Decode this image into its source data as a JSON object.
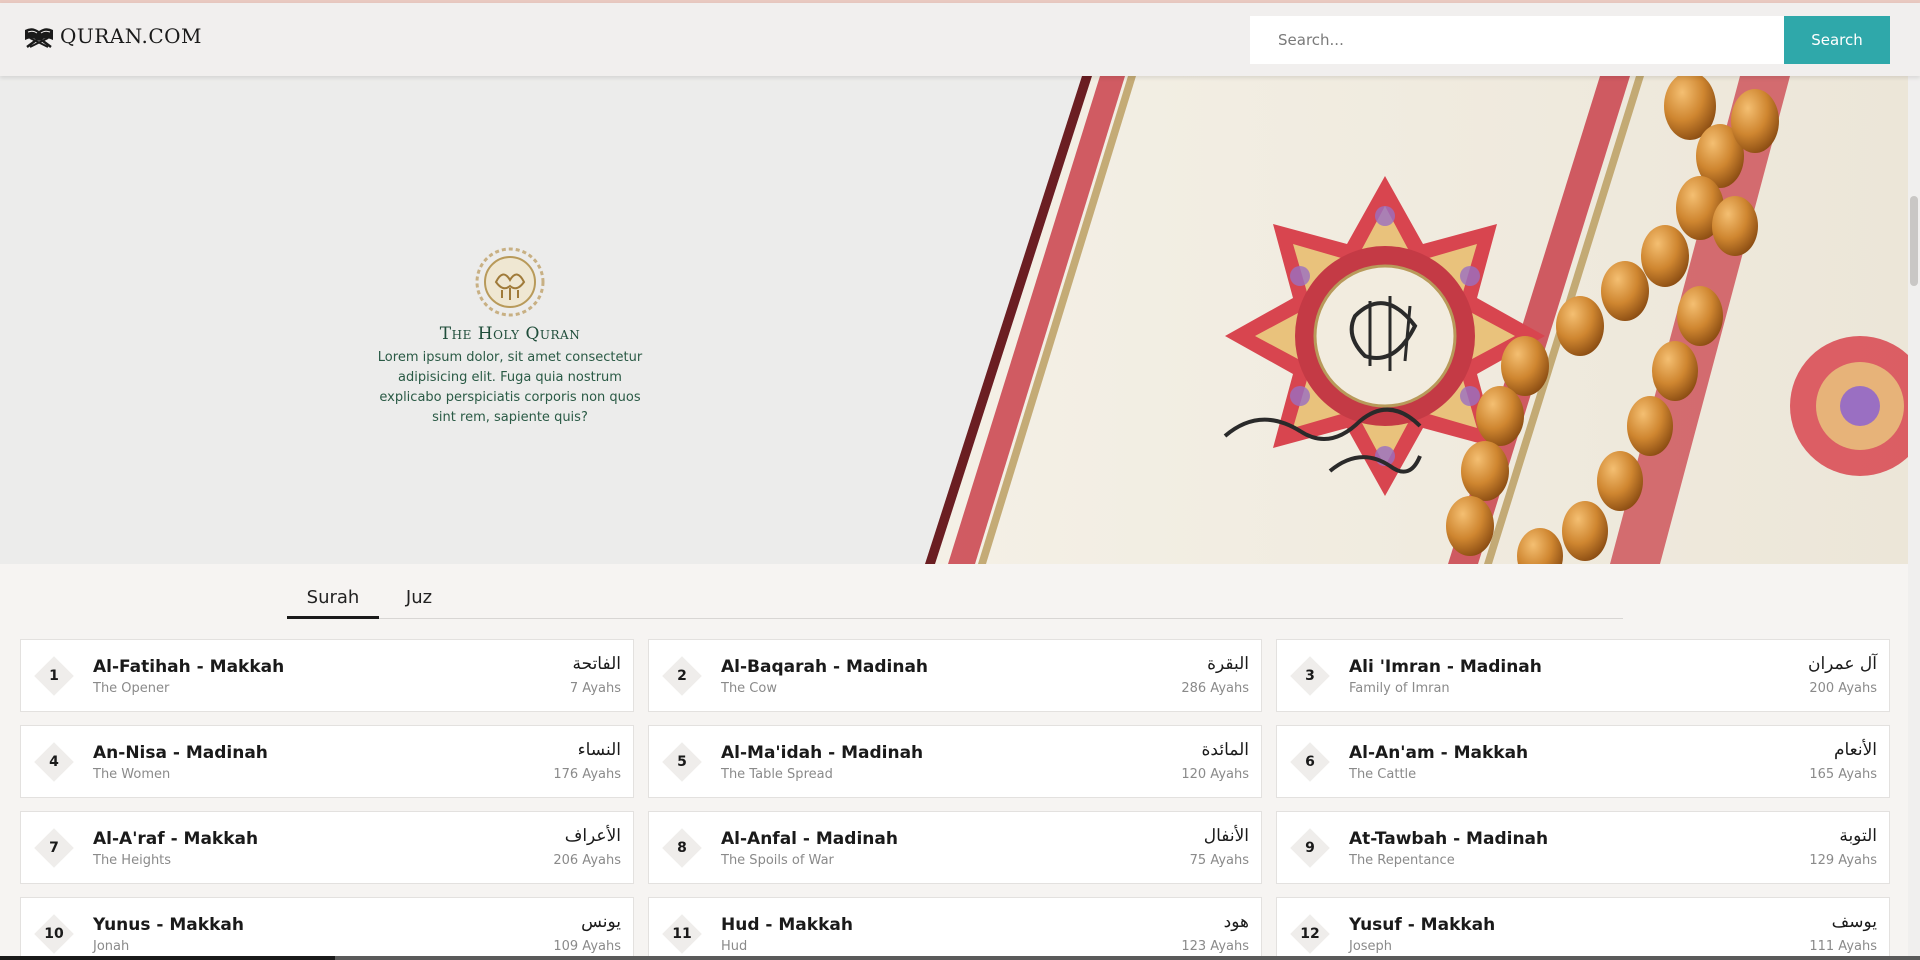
{
  "header": {
    "logo_text": "QURAN.COM",
    "logo_icon": "book-stand-icon",
    "search_placeholder": "Search...",
    "search_button": "Search"
  },
  "hero": {
    "title": "The Holy Quran",
    "description": "Lorem ipsum dolor, sit amet consectetur adipisicing elit. Fuga quia nostrum explicabo perspiciatis corporis non quos sint rem, sapiente quis?"
  },
  "tabs": [
    {
      "label": "Surah",
      "active": true
    },
    {
      "label": "Juz",
      "active": false
    }
  ],
  "surahs": [
    {
      "number": "1",
      "name": "Al-Fatihah - Makkah",
      "meaning": "The Opener",
      "arabic": "الفاتحة",
      "ayahs": "7 Ayahs"
    },
    {
      "number": "2",
      "name": "Al-Baqarah - Madinah",
      "meaning": "The Cow",
      "arabic": "البقرة",
      "ayahs": "286 Ayahs"
    },
    {
      "number": "3",
      "name": "Ali 'Imran - Madinah",
      "meaning": "Family of Imran",
      "arabic": "آل عمران",
      "ayahs": "200 Ayahs"
    },
    {
      "number": "4",
      "name": "An-Nisa - Madinah",
      "meaning": "The Women",
      "arabic": "النساء",
      "ayahs": "176 Ayahs"
    },
    {
      "number": "5",
      "name": "Al-Ma'idah - Madinah",
      "meaning": "The Table Spread",
      "arabic": "المائدة",
      "ayahs": "120 Ayahs"
    },
    {
      "number": "6",
      "name": "Al-An'am - Makkah",
      "meaning": "The Cattle",
      "arabic": "الأنعام",
      "ayahs": "165 Ayahs"
    },
    {
      "number": "7",
      "name": "Al-A'raf - Makkah",
      "meaning": "The Heights",
      "arabic": "الأعراف",
      "ayahs": "206 Ayahs"
    },
    {
      "number": "8",
      "name": "Al-Anfal - Madinah",
      "meaning": "The Spoils of War",
      "arabic": "الأنفال",
      "ayahs": "75 Ayahs"
    },
    {
      "number": "9",
      "name": "At-Tawbah - Madinah",
      "meaning": "The Repentance",
      "arabic": "التوبة",
      "ayahs": "129 Ayahs"
    },
    {
      "number": "10",
      "name": "Yunus - Makkah",
      "meaning": "Jonah",
      "arabic": "يونس",
      "ayahs": "109 Ayahs"
    },
    {
      "number": "11",
      "name": "Hud - Makkah",
      "meaning": "Hud",
      "arabic": "هود",
      "ayahs": "123 Ayahs"
    },
    {
      "number": "12",
      "name": "Yusuf - Makkah",
      "meaning": "Joseph",
      "arabic": "يوسف",
      "ayahs": "111 Ayahs"
    }
  ],
  "colors": {
    "accent": "#2fa8aa",
    "hero_title": "#1f4d3a",
    "muted_text": "#8a8a8a"
  }
}
